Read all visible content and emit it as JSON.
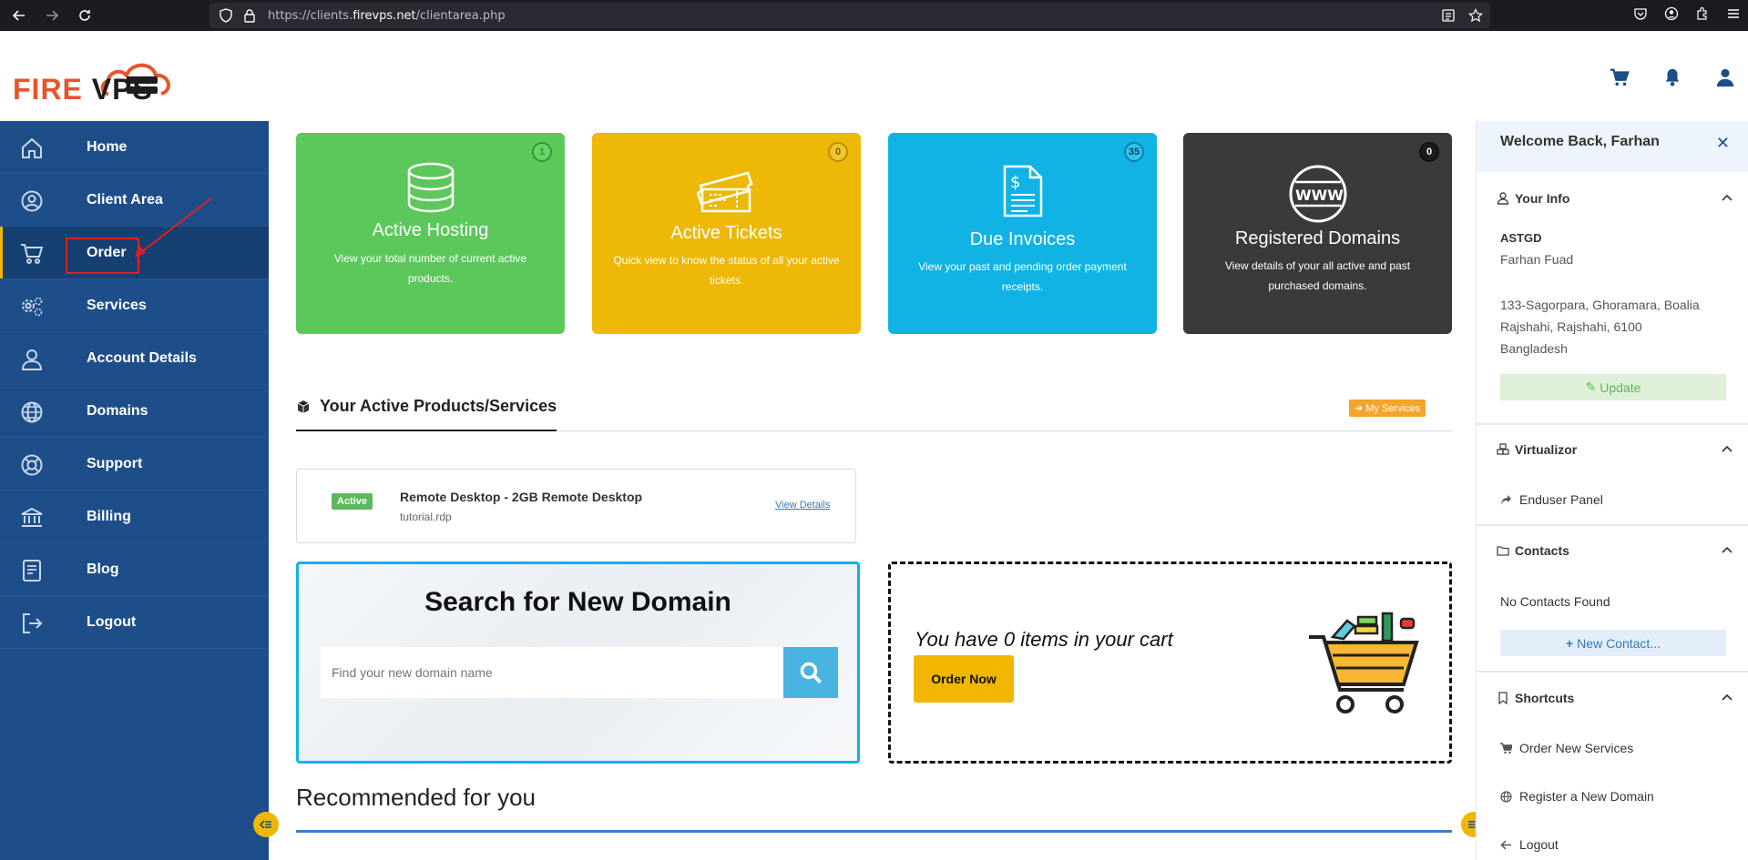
{
  "browser": {
    "url_prefix": "https://clients.",
    "url_domain": "firevps.net",
    "url_path": "/clientarea.php"
  },
  "logo": {
    "part1": "FIRE",
    "part2": "VPS"
  },
  "sidebar": {
    "items": [
      {
        "label": "Home",
        "icon": "home-icon"
      },
      {
        "label": "Client Area",
        "icon": "user-circle-icon"
      },
      {
        "label": "Order",
        "icon": "cart-icon"
      },
      {
        "label": "Services",
        "icon": "gears-icon"
      },
      {
        "label": "Account Details",
        "icon": "user-icon"
      },
      {
        "label": "Domains",
        "icon": "globe-icon"
      },
      {
        "label": "Support",
        "icon": "lifebuoy-icon"
      },
      {
        "label": "Billing",
        "icon": "bank-icon"
      },
      {
        "label": "Blog",
        "icon": "book-icon"
      },
      {
        "label": "Logout",
        "icon": "logout-icon"
      }
    ],
    "active": "Order"
  },
  "cards": [
    {
      "badge": "1",
      "title": "Active Hosting",
      "desc": "View your total number of current active products.",
      "color": "#5cc85c"
    },
    {
      "badge": "0",
      "title": "Active Tickets",
      "desc": "Quick view to know the  status of all your active tickets.",
      "color": "#edb806"
    },
    {
      "badge": "35",
      "title": "Due Invoices",
      "desc": "View your past and pending order payment receipts.",
      "color": "#11b3e4"
    },
    {
      "badge": "0",
      "title": "Registered Domains",
      "desc": "View details of your all active and past purchased domains.",
      "color": "#3a3a3a"
    }
  ],
  "products_section": {
    "title": "Your Active Products/Services",
    "my_services": "My Services",
    "product": {
      "status": "Active",
      "name": "Remote Desktop - 2GB Remote Desktop",
      "domain": "tutorial.rdp",
      "link": "View Details"
    }
  },
  "domain_search": {
    "title": "Search for New Domain",
    "placeholder": "Find your new domain name"
  },
  "cart": {
    "text": "You have 0 items in your cart",
    "button": "Order Now"
  },
  "recommended": {
    "title": "Recommended for you"
  },
  "right_panel": {
    "welcome": "Welcome Back, Farhan",
    "your_info": {
      "title": "Your Info",
      "company": "ASTGD",
      "name": "Farhan Fuad",
      "address1": "133-Sagorpara, Ghoramara, Boalia",
      "address2": "Rajshahi, Rajshahi, 6100",
      "country": "Bangladesh",
      "update": "Update"
    },
    "virtualizor": {
      "title": "Virtualizor",
      "link": "Enduser Panel"
    },
    "contacts": {
      "title": "Contacts",
      "empty": "No Contacts Found",
      "button": "New Contact..."
    },
    "shortcuts": {
      "title": "Shortcuts",
      "items": [
        "Order New Services",
        "Register a New Domain",
        "Logout"
      ]
    }
  },
  "colors": {
    "sidebar": "#1d4e89",
    "accent": "#f2b600",
    "highlight": "#e02020"
  }
}
